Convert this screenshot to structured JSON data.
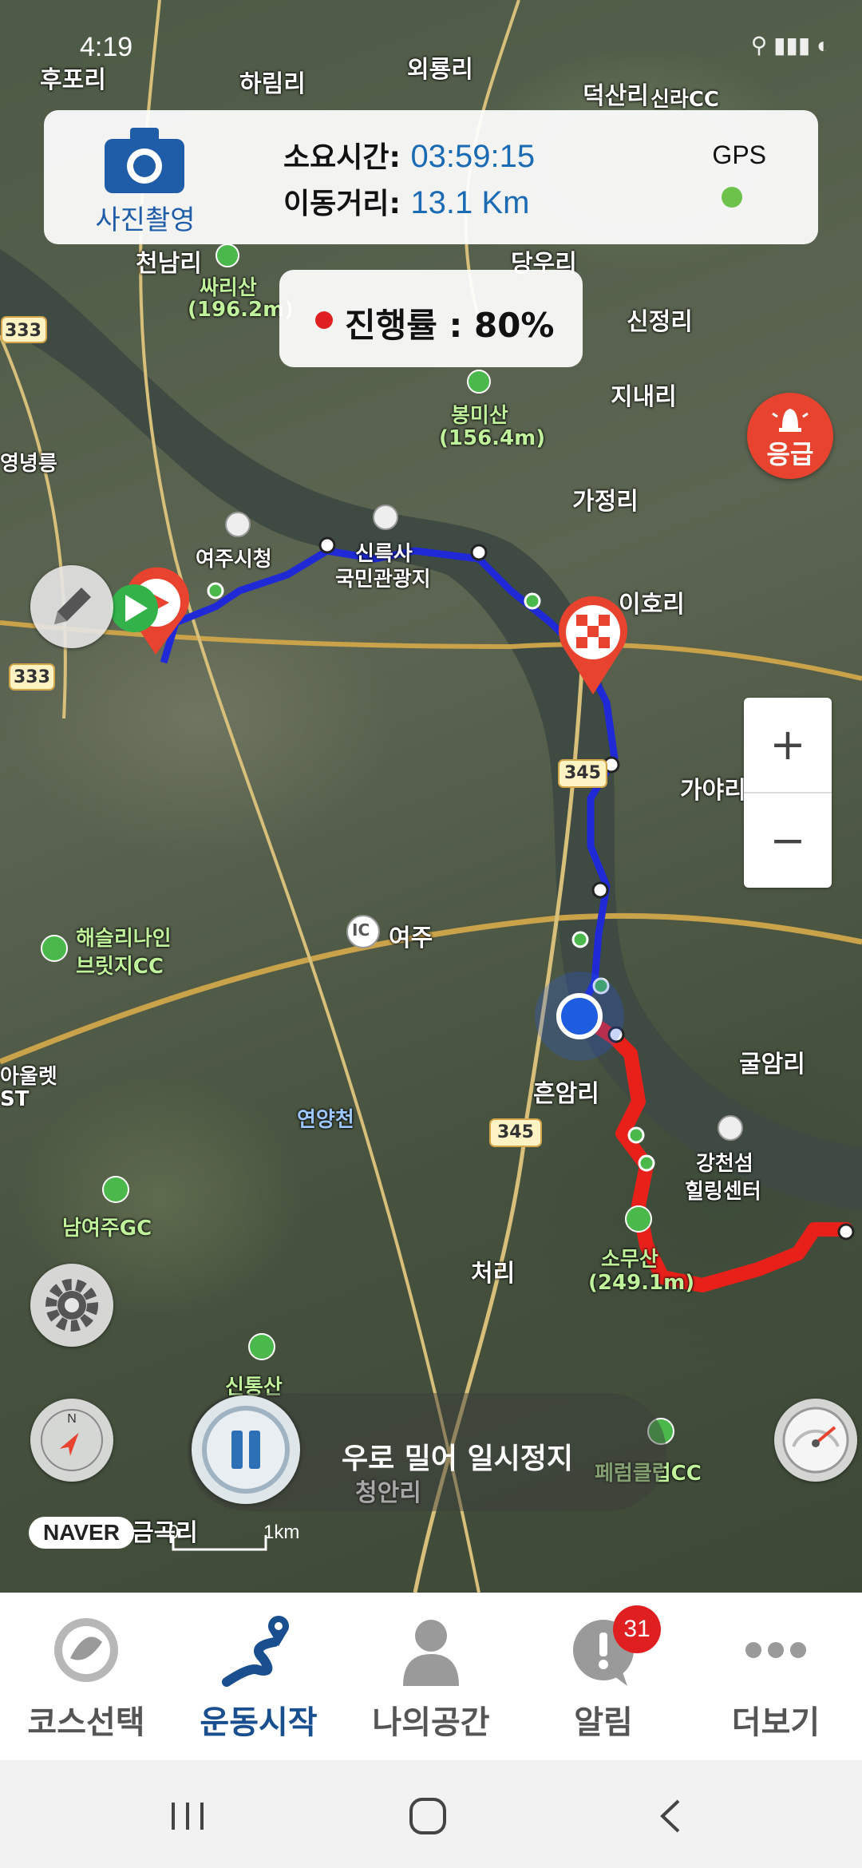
{
  "status_bar": {
    "time": "4:19"
  },
  "info_panel": {
    "camera_label": "사진촬영",
    "elapsed_label": "소요시간:",
    "elapsed_value": "03:59:15",
    "distance_label": "이동거리:",
    "distance_value": "13.1 Km",
    "gps_label": "GPS",
    "gps_status_color": "#6cc24a"
  },
  "progress_pill": {
    "text": "진행률 : 80%"
  },
  "emergency_button": {
    "label": "응급",
    "color": "#e8432e"
  },
  "zoom_controls": {
    "plus": "+",
    "minus": "−"
  },
  "map": {
    "road_numbers": [
      "333",
      "333",
      "345",
      "345"
    ],
    "labels": {
      "hupori": "후포리",
      "harimri": "하림리",
      "oeryongri": "외룡리",
      "deoksanri": "덕산리",
      "sillacc": "신라CC",
      "cheonnamri": "천남리",
      "ssarisan": "싸리산",
      "ssarisan_h": "(196.2m)",
      "danguri": "당우리",
      "sinjeongri": "신정리",
      "bongmisan": "봉미산",
      "bongmisan_h": "(156.4m)",
      "jinaeri": "지내리",
      "yeongneung": "영녕릉",
      "gajeongri": "가정리",
      "yeoju_cityhall": "여주시청",
      "silleuksa": "신륵사",
      "silleuksa2": "국민관광지",
      "ihori": "이호리",
      "gayari": "가야리",
      "ic": "IC",
      "yeoju": "여주",
      "haesol": "해슬리나인",
      "haesol2": "브릿지CC",
      "outlet": "아울렛",
      "outlet2": "ST",
      "yeonyangcheon": "연양천",
      "heunamri": "흔암리",
      "gulamri": "굴암리",
      "gangcheonseom": "강천섬",
      "gangcheonseom2": "힐링센터",
      "namyeojugc": "남여주GC",
      "somusan": "소무산",
      "somusan_h": "(249.1m)",
      "cheori": "처리",
      "sintongsan": "신통산",
      "cheongari": "청안리",
      "geumgari": "금곡리",
      "perumclubcc": "페럼클럽CC"
    },
    "scale_start": "0",
    "scale_end": "1km",
    "attribution": "NAVER",
    "route_done_color": "#1f2ad6",
    "route_remaining_color": "#e8201a"
  },
  "pause_control": {
    "hint": "우로 밀어 일시정지"
  },
  "tabs": [
    {
      "label": "코스선택",
      "icon": "course-logo-icon",
      "active": false
    },
    {
      "label": "운동시작",
      "icon": "route-icon",
      "active": true
    },
    {
      "label": "나의공간",
      "icon": "person-icon",
      "active": false
    },
    {
      "label": "알림",
      "icon": "alert-bubble-icon",
      "active": false,
      "badge": "31"
    },
    {
      "label": "더보기",
      "icon": "more-dots-icon",
      "active": false
    }
  ],
  "colors": {
    "active_tab": "#1a4f8f",
    "accent_blue": "#1a6bb3"
  }
}
